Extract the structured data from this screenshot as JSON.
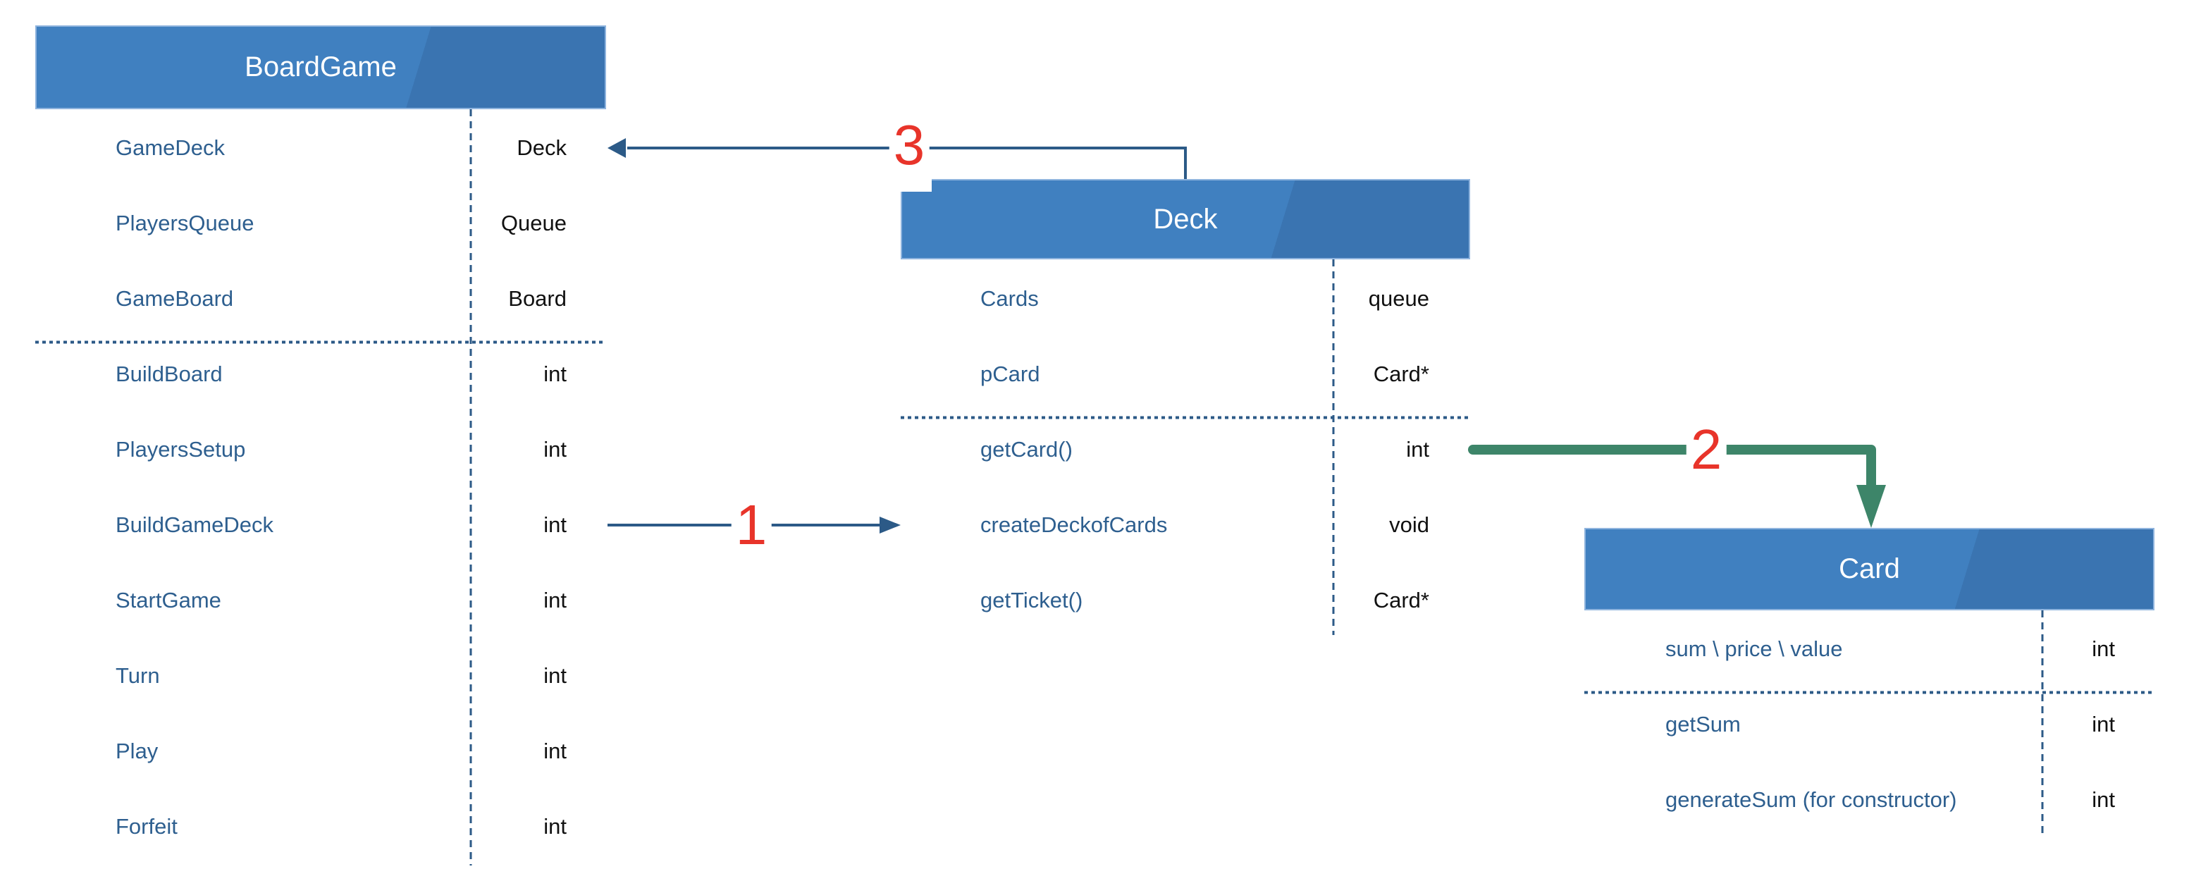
{
  "colors": {
    "header": "#4080c0",
    "header_dark": "#3a74b1",
    "member_name": "#2e5f8f",
    "arrow_blue": "#2c5a87",
    "arrow_green": "#3d8569",
    "label_red": "#e8342a"
  },
  "classes": [
    {
      "title": "BoardGame",
      "attributes": [
        {
          "name": "GameDeck",
          "type": "Deck"
        },
        {
          "name": "PlayersQueue",
          "type": "Queue"
        },
        {
          "name": "GameBoard",
          "type": "Board"
        }
      ],
      "methods": [
        {
          "name": "BuildBoard",
          "type": "int"
        },
        {
          "name": "PlayersSetup",
          "type": "int"
        },
        {
          "name": "BuildGameDeck",
          "type": "int"
        },
        {
          "name": "StartGame",
          "type": "int"
        },
        {
          "name": "Turn",
          "type": "int"
        },
        {
          "name": "Play",
          "type": "int"
        },
        {
          "name": "Forfeit",
          "type": "int"
        }
      ]
    },
    {
      "title": "Deck",
      "attributes": [
        {
          "name": "Cards",
          "type": "queue"
        },
        {
          "name": "pCard",
          "type": "Card*"
        }
      ],
      "methods": [
        {
          "name": "getCard()",
          "type": "int"
        },
        {
          "name": "createDeckofCards",
          "type": "void"
        },
        {
          "name": "getTicket()",
          "type": "Card*"
        }
      ]
    },
    {
      "title": "Card",
      "attributes": [
        {
          "name": "sum \\ price \\ value",
          "type": "int"
        }
      ],
      "methods": [
        {
          "name": "getSum",
          "type": "int"
        },
        {
          "name": "generateSum (for constructor)",
          "type": "int"
        }
      ]
    }
  ],
  "connectors": [
    {
      "label": "1",
      "from": "BoardGame.BuildGameDeck",
      "to": "Deck"
    },
    {
      "label": "2",
      "from": "Deck.getCard()",
      "to": "Card"
    },
    {
      "label": "3",
      "from": "Deck",
      "to": "BoardGame.GameDeck"
    }
  ]
}
